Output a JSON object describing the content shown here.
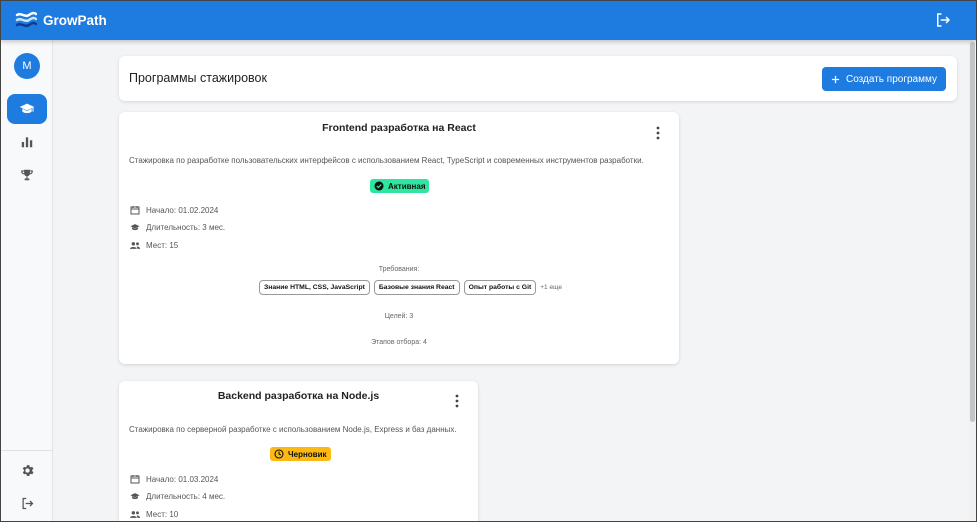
{
  "app": {
    "name": "GrowPath",
    "brand_color": "#1e7be0"
  },
  "sidebar": {
    "avatar_initial": "M",
    "items": [
      {
        "icon": "graduation-cap-icon",
        "active": true
      },
      {
        "icon": "bar-chart-icon",
        "active": false
      },
      {
        "icon": "trophy-icon",
        "active": false
      }
    ],
    "bottom_items": [
      {
        "icon": "gear-icon"
      },
      {
        "icon": "logout-icon"
      }
    ]
  },
  "header": {
    "title": "Программы стажировок",
    "create_button_label": "Создать программу",
    "create_button_icon": "plus-icon"
  },
  "programs": [
    {
      "title": "Frontend разработка на React",
      "description": "Стажировка по разработке пользовательских интерфейсов с использованием React, TypeScript и современных инструментов разработки.",
      "status": "Активная",
      "status_color": "#2ee6a0",
      "start": "Начало: 01.02.2024",
      "duration": "Длительность: 3 мес.",
      "seats": "Мест: 15",
      "requirements_label": "Требования:",
      "requirements": [
        "Знание HTML, CSS, JavaScript",
        "Базовые знания React",
        "Опыт работы с Git"
      ],
      "requirements_more": "+1 еще",
      "goals": "Целей: 3",
      "stages": "Этапов отбора: 4"
    },
    {
      "title": "Backend разработка на Node.js",
      "description": "Стажировка по серверной разработке с использованием Node.js, Express и баз данных.",
      "status": "Черновик",
      "status_color": "#fdb913",
      "start": "Начало: 01.03.2024",
      "duration": "Длительность: 4 мес.",
      "seats": "Мест: 10"
    }
  ]
}
